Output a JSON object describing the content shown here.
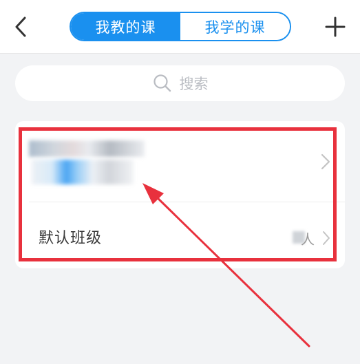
{
  "header": {
    "back_icon": "chevron-left-icon",
    "tabs": [
      {
        "label": "我教的课",
        "active": true
      },
      {
        "label": "我学的课",
        "active": false
      }
    ],
    "add_icon": "plus-icon",
    "accent_color": "#1a90ef"
  },
  "search": {
    "icon": "search-icon",
    "placeholder": "搜索"
  },
  "course_card": {
    "course_name_obscured": true,
    "class_row": {
      "name": "默认班级",
      "member_count_obscured": true,
      "member_count_unit": "人"
    }
  },
  "annotation": {
    "color": "#e8313d",
    "highlight": "course_card",
    "arrow_icon": "arrow-pointer-icon"
  }
}
